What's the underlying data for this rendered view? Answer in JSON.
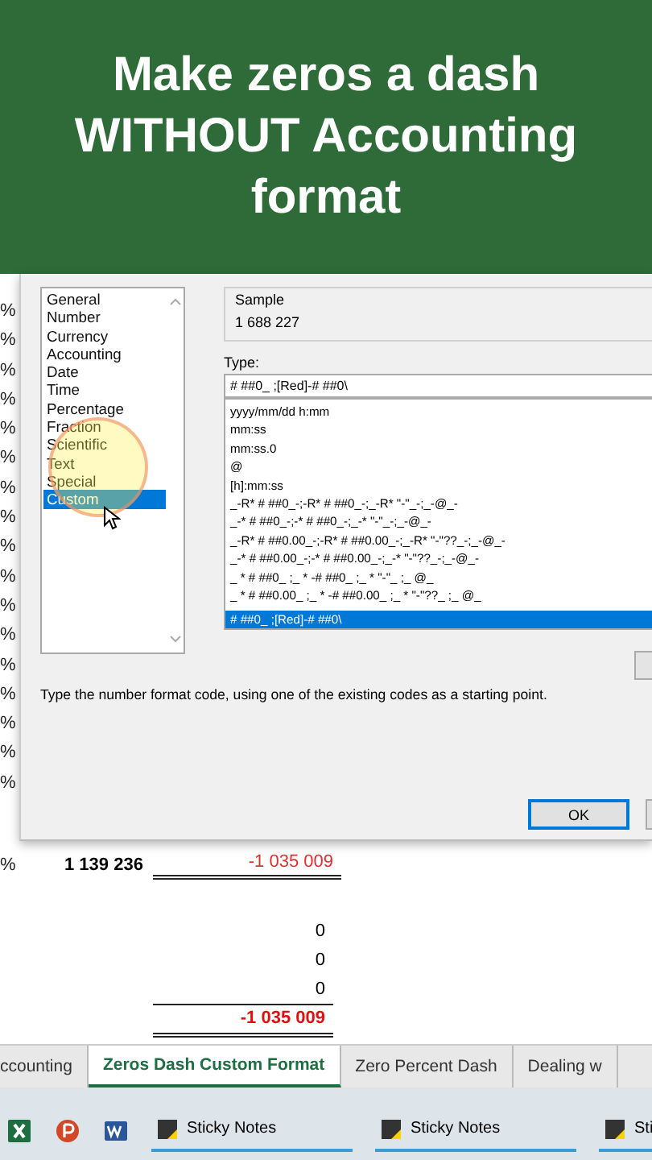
{
  "banner": {
    "title": "Make zeros a dash WITHOUT Accounting format"
  },
  "sheet": {
    "percent_cells": [
      "%",
      "%",
      "%",
      "%",
      "%",
      "%",
      "%",
      "%",
      "%",
      "%",
      "%",
      "%",
      "%",
      "%",
      "%",
      "%",
      "%"
    ]
  },
  "dialog": {
    "categories": [
      {
        "label": "General",
        "selected": false
      },
      {
        "label": "Number",
        "selected": false
      },
      {
        "label": "Currency",
        "selected": false
      },
      {
        "label": "Accounting",
        "selected": false
      },
      {
        "label": "Date",
        "selected": false
      },
      {
        "label": "Time",
        "selected": false
      },
      {
        "label": "Percentage",
        "selected": false
      },
      {
        "label": "Fraction",
        "selected": false
      },
      {
        "label": "Scientific",
        "selected": false
      },
      {
        "label": "Text",
        "selected": false
      },
      {
        "label": "Special",
        "selected": false
      },
      {
        "label": "Custom",
        "selected": true
      }
    ],
    "sample": {
      "label": "Sample",
      "value": "1 688 227"
    },
    "type": {
      "label": "Type:",
      "value": "# ##0_ ;[Red]-# ##0\\"
    },
    "type_list": [
      {
        "text": "yyyy/mm/dd h:mm",
        "selected": false
      },
      {
        "text": "mm:ss",
        "selected": false
      },
      {
        "text": "mm:ss.0",
        "selected": false
      },
      {
        "text": "@",
        "selected": false
      },
      {
        "text": "[h]:mm:ss",
        "selected": false
      },
      {
        "text": "_-R* # ##0_-;-R* # ##0_-;_-R* \"-\"_-;_-@_-",
        "selected": false
      },
      {
        "text": "_-* # ##0_-;-* # ##0_-;_-* \"-\"_-;_-@_-",
        "selected": false
      },
      {
        "text": "_-R* # ##0.00_-;-R* # ##0.00_-;_-R* \"-\"??_-;_-@_-",
        "selected": false
      },
      {
        "text": "_-* # ##0.00_-;-* # ##0.00_-;_-* \"-\"??_-;_-@_-",
        "selected": false
      },
      {
        "text": "_ * # ##0_ ;_ * -# ##0_ ;_ * \"-\"_ ;_ @_",
        "selected": false
      },
      {
        "text": "_ * # ##0.00_ ;_ * -# ##0.00_ ;_ * \"-\"??_ ;_ @_",
        "selected": false
      },
      {
        "text": "# ##0_ ;[Red]-# ##0\\",
        "selected": true
      }
    ],
    "hint": "Type the number format code, using one of the existing codes as a starting point.",
    "ok": "OK"
  },
  "totals": {
    "percent": "%",
    "value": "1 139 236",
    "amount": "-1 035 009",
    "zeros": [
      "0",
      "0",
      "0"
    ],
    "total": "-1 035 009"
  },
  "sheet_tabs": [
    {
      "label": "ccounting",
      "selected": false
    },
    {
      "label": "Zeros Dash Custom Format",
      "selected": true
    },
    {
      "label": "Zero Percent Dash",
      "selected": false
    },
    {
      "label": "Dealing w",
      "selected": false
    }
  ],
  "taskbar": [
    {
      "kind": "excel"
    },
    {
      "kind": "powerpoint"
    },
    {
      "kind": "word"
    },
    {
      "kind": "sticky",
      "label": "Sticky Notes"
    },
    {
      "kind": "sticky",
      "label": "Sticky Notes"
    },
    {
      "kind": "sticky",
      "label": "Sti"
    }
  ]
}
